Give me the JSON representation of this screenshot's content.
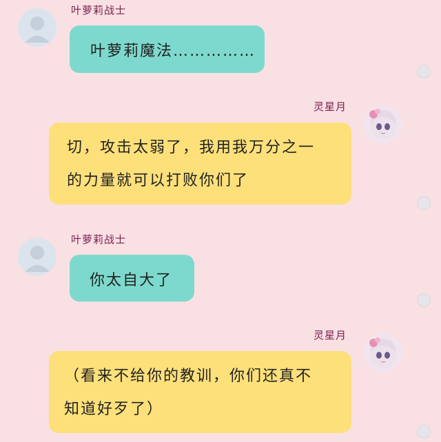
{
  "conversation": [
    {
      "side": "left",
      "sender": "叶萝莉战士",
      "avatar_icon": "default-user-avatar-icon",
      "bubble_color": "#7dd9cd",
      "lines": [
        "叶萝莉魔法……………"
      ]
    },
    {
      "side": "right",
      "sender": "灵星月",
      "avatar_icon": "anime-girl-avatar-icon",
      "bubble_color": "#fde07a",
      "lines": [
        "切，攻击太弱了，我用我万分之一",
        "的力量就可以打败你们了"
      ]
    },
    {
      "side": "left",
      "sender": "叶萝莉战士",
      "avatar_icon": "default-user-avatar-icon",
      "bubble_color": "#7dd9cd",
      "lines": [
        "你太自大了"
      ]
    },
    {
      "side": "right",
      "sender": "灵星月",
      "avatar_icon": "anime-girl-avatar-icon",
      "bubble_color": "#fde07a",
      "lines": [
        "（看来不给你的教训，你们还真不",
        "知道好歹了）"
      ]
    }
  ]
}
